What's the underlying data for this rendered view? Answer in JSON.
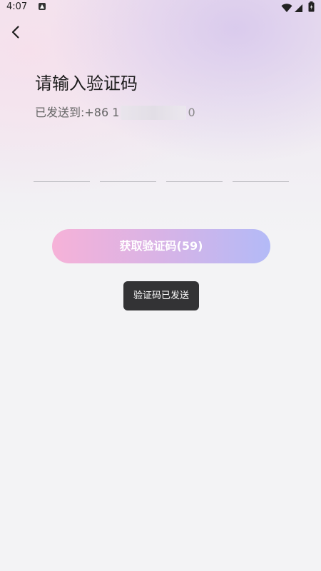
{
  "status_bar": {
    "time": "4:07",
    "icons": [
      "notification-icon",
      "wifi-icon",
      "signal-icon",
      "battery-icon"
    ]
  },
  "header": {
    "back_icon": "back-arrow-icon"
  },
  "main": {
    "title": "请输入验证码",
    "sent_to_label": "已发送到:+86 1",
    "phone_end": "0",
    "code_inputs": [
      "",
      "",
      "",
      ""
    ],
    "get_code_button": "获取验证码(59)"
  },
  "toast": {
    "text": "验证码已发送"
  },
  "colors": {
    "button_gradient_start": "#f6b2d8",
    "button_gradient_end": "#b3baf7",
    "toast_bg": "#333335",
    "background": "#f3f3f5"
  }
}
